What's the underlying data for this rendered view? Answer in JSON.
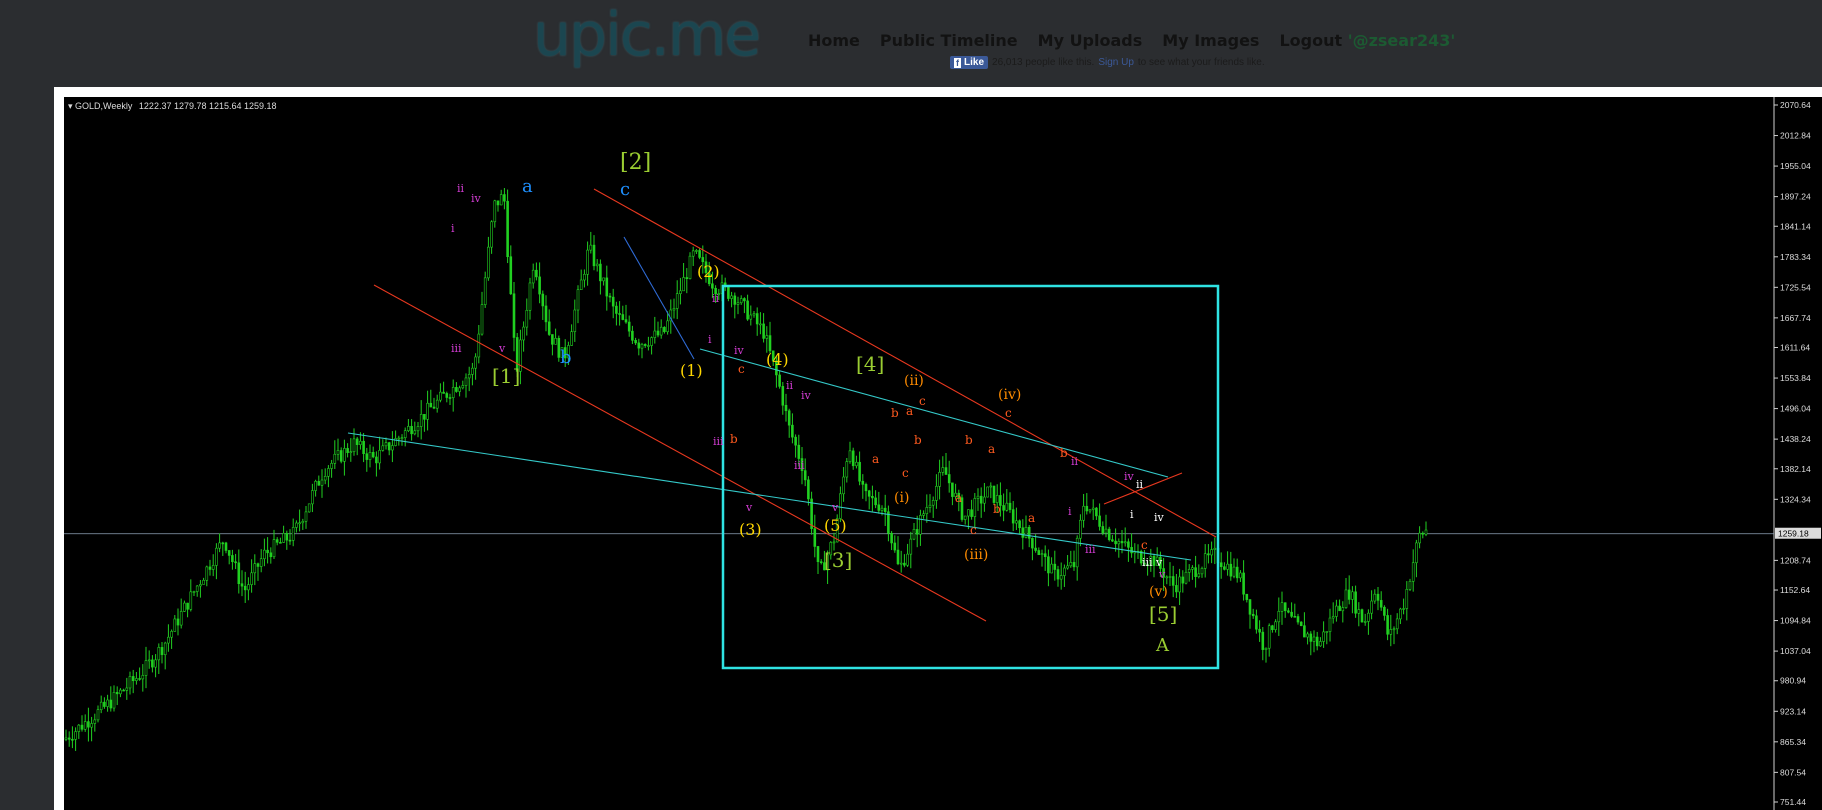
{
  "site": {
    "logo": "upic.me"
  },
  "nav": {
    "home": "Home",
    "timeline": "Public Timeline",
    "uploads": "My Uploads",
    "images": "My Images",
    "logout": "Logout",
    "user": "'@zsear243'"
  },
  "facebook": {
    "like_label": "Like",
    "count_text": "26,013 people like this.",
    "signup_link": "Sign Up",
    "tail_text": "to see what your friends like."
  },
  "chart_data": {
    "type": "candlestick",
    "symbol": "GOLD,Weekly",
    "ohlc": "1222.37 1279.78 1215.64 1259.18",
    "current_price": "1259.18",
    "y_ticks": [
      "2070.64",
      "2012.84",
      "1955.04",
      "1897.24",
      "1841.14",
      "1783.34",
      "1725.54",
      "1667.74",
      "1611.64",
      "1553.84",
      "1496.04",
      "1438.24",
      "1382.14",
      "1324.34",
      "1208.74",
      "1152.64",
      "1094.84",
      "1037.04",
      "980.94",
      "923.14",
      "865.34",
      "807.54",
      "751.44"
    ],
    "ylim": [
      751.44,
      2070.64
    ],
    "wave_labels": [
      {
        "t": "[2]",
        "c": "#9acd32"
      },
      {
        "t": "c",
        "c": "#1e90ff"
      },
      {
        "t": "a",
        "c": "#1e90ff"
      },
      {
        "t": "b",
        "c": "#1e90ff"
      },
      {
        "t": "[1]",
        "c": "#9acd32"
      },
      {
        "t": "[3]",
        "c": "#9acd32"
      },
      {
        "t": "[4]",
        "c": "#9acd32"
      },
      {
        "t": "[5]",
        "c": "#9acd32"
      },
      {
        "t": "A",
        "c": "#9acd32"
      },
      {
        "t": "(1)",
        "c": "#ffd700"
      },
      {
        "t": "(2)",
        "c": "#ffd700"
      },
      {
        "t": "(3)",
        "c": "#ffd700"
      },
      {
        "t": "(4)",
        "c": "#ffd700"
      },
      {
        "t": "(5)",
        "c": "#ffd700"
      },
      {
        "t": "(i)",
        "c": "#ff8c00"
      },
      {
        "t": "(ii)",
        "c": "#ff8c00"
      },
      {
        "t": "(iii)",
        "c": "#ff8c00"
      },
      {
        "t": "(iv)",
        "c": "#ff8c00"
      },
      {
        "t": "(v)",
        "c": "#ff8c00"
      }
    ]
  }
}
